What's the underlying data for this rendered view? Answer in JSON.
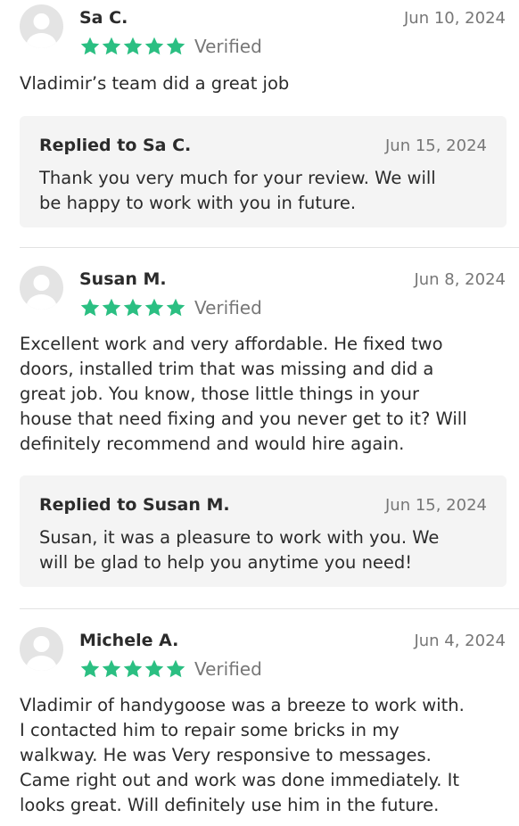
{
  "accent_color": "#2bbf82",
  "reviews": [
    {
      "author": "Sa C.",
      "date": "Jun 10, 2024",
      "rating": 5,
      "verified_label": "Verified",
      "text": "Vladimir’s team did a great job",
      "reply": {
        "title": "Replied to Sa C.",
        "date": "Jun 15, 2024",
        "text": "Thank you very much for your review. We will\nbe happy to work with you in future."
      }
    },
    {
      "author": "Susan M.",
      "date": "Jun 8, 2024",
      "rating": 5,
      "verified_label": "Verified",
      "text": "Excellent work and very affordable. He fixed two\ndoors, installed trim that was missing and did a\ngreat job. You know, those little things in your\nhouse that need fixing and you never get to it? Will\ndefinitely recommend and would hire again.",
      "reply": {
        "title": "Replied to Susan M.",
        "date": "Jun 15, 2024",
        "text": "Susan, it was a pleasure to work with you. We\nwill be glad to help you anytime you need!"
      }
    },
    {
      "author": "Michele A.",
      "date": "Jun 4, 2024",
      "rating": 5,
      "verified_label": "Verified",
      "text": "Vladimir of handygoose was a breeze to work with.\nI contacted him to repair some bricks in my\nwalkway. He was Very responsive to messages.\nCame right out and work was done immediately. It\nlooks great. Will definitely use him in the future."
    }
  ]
}
